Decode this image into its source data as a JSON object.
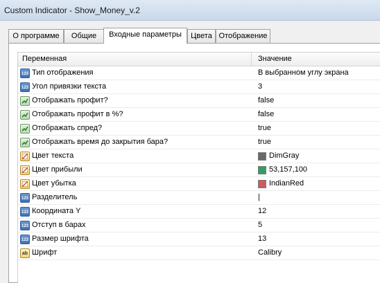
{
  "window": {
    "title": "Custom Indicator - Show_Money_v.2"
  },
  "tabs": [
    {
      "label": "О программе"
    },
    {
      "label": "Общие"
    },
    {
      "label": "Входные параметры",
      "active": true
    },
    {
      "label": "Цвета"
    },
    {
      "label": "Отображение"
    }
  ],
  "grid": {
    "col_variable": "Переменная",
    "col_value": "Значение",
    "rows": [
      {
        "name": "Тип отображения",
        "value": "В выбранном углу экрана",
        "icon": "int-icon"
      },
      {
        "name": "Угол привязки текста",
        "value": "3",
        "icon": "int-icon"
      },
      {
        "name": "Отображать профит?",
        "value": "false",
        "icon": "bool-icon"
      },
      {
        "name": "Отображать профит в %?",
        "value": "false",
        "icon": "bool-icon"
      },
      {
        "name": "Отображать спред?",
        "value": "true",
        "icon": "bool-icon"
      },
      {
        "name": "Отображать время до закрытия бара?",
        "value": "true",
        "icon": "bool-icon"
      },
      {
        "name": "Цвет текста",
        "value": "DimGray",
        "icon": "color-icon",
        "swatch": "#696969"
      },
      {
        "name": "Цвет прибыли",
        "value": "53,157,100",
        "icon": "color-icon",
        "swatch": "#359d64"
      },
      {
        "name": "Цвет убытка",
        "value": "IndianRed",
        "icon": "color-icon",
        "swatch": "#cd5c5c"
      },
      {
        "name": "Разделитель",
        "value": "|",
        "icon": "int-icon"
      },
      {
        "name": "Координата Y",
        "value": "12",
        "icon": "int-icon"
      },
      {
        "name": "Отступ в барах",
        "value": "5",
        "icon": "int-icon"
      },
      {
        "name": "Размер шрифта",
        "value": "13",
        "icon": "int-icon"
      },
      {
        "name": "Шрифт",
        "value": "Calibry",
        "icon": "string-icon"
      }
    ]
  }
}
